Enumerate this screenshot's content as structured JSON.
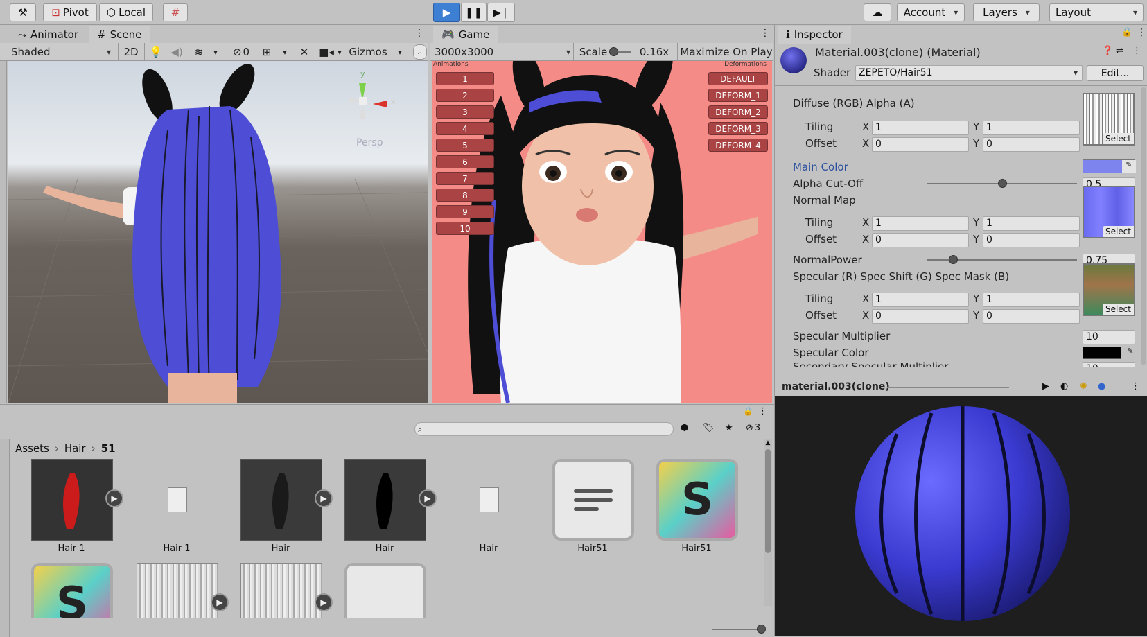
{
  "toolbar": {
    "pivot_label": "Pivot",
    "local_label": "Local",
    "account_label": "Account",
    "layers_label": "Layers",
    "layout_label": "Layout"
  },
  "scene_panel": {
    "tab_animator": "Animator",
    "tab_scene": "Scene",
    "shading_mode": "Shaded",
    "mode_2d": "2D",
    "hidden_count": "0",
    "gizmos_label": "Gizmos",
    "axis_y": "y",
    "axis_x": "x",
    "persp_label": "Persp"
  },
  "game_panel": {
    "tab_game": "Game",
    "resolution": "3000x3000",
    "scale_label": "Scale",
    "scale_value": "0.16x",
    "maximize_label": "Maximize On Play",
    "animations_header": "Animations",
    "deformations_header": "Deformations",
    "animation_buttons": [
      "1",
      "2",
      "3",
      "4",
      "5",
      "6",
      "7",
      "8",
      "9",
      "10"
    ],
    "deformation_buttons": [
      "DEFAULT",
      "DEFORM_1",
      "DEFORM_2",
      "DEFORM_3",
      "DEFORM_4"
    ]
  },
  "inspector": {
    "tab_label": "Inspector",
    "material_name": "Material.003(clone) (Material)",
    "shader_label": "Shader",
    "shader_value": "ZEPETO/Hair51",
    "edit_label": "Edit...",
    "diffuse_label": "Diffuse (RGB) Alpha (A)",
    "tiling_label": "Tiling",
    "offset_label": "Offset",
    "x_label": "X",
    "y_label": "Y",
    "tiling_x": "1",
    "tiling_y": "1",
    "offset_x": "0",
    "offset_y": "0",
    "select_label": "Select",
    "main_color_label": "Main Color",
    "main_color": "#7d84ee",
    "alpha_cutoff_label": "Alpha Cut-Off",
    "alpha_cutoff_value": "0.5",
    "alpha_cutoff_fraction": 0.5,
    "normal_map_label": "Normal Map",
    "normal_power_label": "NormalPower",
    "normal_power_value": "0.75",
    "normal_power_fraction": 0.17,
    "specular_label": "Specular (R) Spec Shift (G) Spec Mask (B)",
    "spec_mult_label": "Specular Multiplier",
    "spec_mult_value": "10",
    "spec_color_label": "Specular Color",
    "spec_color": "#000000",
    "secondary_label": "Secondary Specular Multiplier",
    "secondary_value": "10"
  },
  "preview": {
    "title": "material.003(clone)"
  },
  "project": {
    "hidden_count": "3",
    "breadcrumb": [
      "Assets",
      "Hair",
      "51"
    ],
    "assets": [
      {
        "name": "Hair 1",
        "kind": "anim-red"
      },
      {
        "name": "Hair 1",
        "kind": "file"
      },
      {
        "name": "Hair",
        "kind": "anim-dark"
      },
      {
        "name": "Hair",
        "kind": "anim-black"
      },
      {
        "name": "Hair",
        "kind": "file"
      },
      {
        "name": "Hair51",
        "kind": "doc"
      },
      {
        "name": "Hair51",
        "kind": "shader"
      }
    ]
  },
  "colors": {
    "game_bg": "#f48b87",
    "scene_sky": "#d9dde2",
    "hair_blue": "#4d4dd6",
    "play_active": "#3d7fd3"
  }
}
